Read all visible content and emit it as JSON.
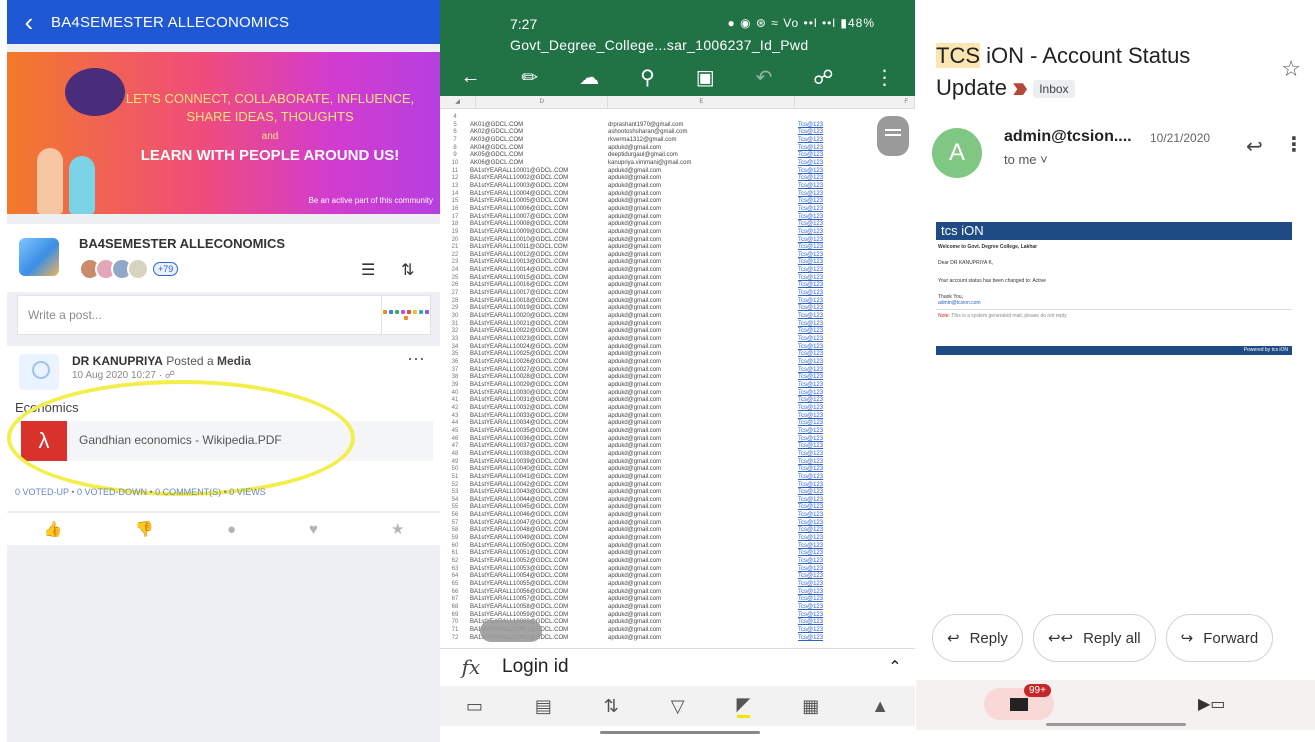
{
  "community": {
    "header_title": "BA4SEMESTER ALLECONOMICS",
    "banner": {
      "line1": "LET'S CONNECT, COLLABORATE, INFLUENCE,",
      "line2": "SHARE IDEAS, THOUGHTS",
      "and": "and",
      "headline": "LEARN WITH PEOPLE AROUND US!",
      "tagline": "Be an active part of this community"
    },
    "group_name": "BA4SEMESTER ALLECONOMICS",
    "member_count": "+79",
    "write_placeholder": "Write a post...",
    "post": {
      "author": "DR KANUPRIYA",
      "action": "Posted a",
      "type": "Media",
      "date": "10 Aug 2020 10:27",
      "title": "Economics",
      "file_name": "Gandhian economics - Wikipedia.PDF",
      "stats": "0 VOTED-UP  •  0 VOTED-DOWN  •  0 COMMENT(S)  •  0 VIEWS"
    },
    "colors": {
      "appbar": "#1f58d4",
      "highlight": "#f2ee4a",
      "pdf": "#d9322b"
    }
  },
  "spreadsheet": {
    "time": "7:27",
    "status_text": "48%",
    "file_title": "Govt_Degree_College...sar_1006237_Id_Pwd",
    "columns": [
      "D",
      "E",
      "F"
    ],
    "rows": [
      [
        "4",
        "",
        "",
        ""
      ],
      [
        "5",
        "AK01@GDCL.COM",
        "drprashant1970@gmail.com",
        "Tcs@123"
      ],
      [
        "6",
        "AK02@GDCL.COM",
        "ashootoshsharan@gmail.com",
        "Tcs@123"
      ],
      [
        "7",
        "AK03@GDCL.COM",
        "rkverma1312@gmail.com",
        "Tcs@123"
      ],
      [
        "8",
        "AK04@GDCL.COM",
        "apdukd@gmail.com",
        "Tcs@123"
      ],
      [
        "9",
        "AK05@GDCL.COM",
        "deeptidurgaul@gmail.com",
        "Tcs@123"
      ],
      [
        "10",
        "AK06@GDCL.COM",
        "kanupriya.vimmani@gmail.com",
        "Tcs@123"
      ],
      [
        "11",
        "BA1stYEARALL10001@GDCL.COM",
        "apdukd@gmail.com",
        "Tcs@123"
      ],
      [
        "12",
        "BA1stYEARALL10002@GDCL.COM",
        "apdukd@gmail.com",
        "Tcs@123"
      ],
      [
        "13",
        "BA1stYEARALL10003@GDCL.COM",
        "apdukd@gmail.com",
        "Tcs@123"
      ],
      [
        "14",
        "BA1stYEARALL10004@GDCL.COM",
        "apdukd@gmail.com",
        "Tcs@123"
      ],
      [
        "15",
        "BA1stYEARALL10005@GDCL.COM",
        "apdukd@gmail.com",
        "Tcs@123"
      ],
      [
        "16",
        "BA1stYEARALL10006@GDCL.COM",
        "apdukd@gmail.com",
        "Tcs@123"
      ],
      [
        "17",
        "BA1stYEARALL10007@GDCL.COM",
        "apdukd@gmail.com",
        "Tcs@123"
      ],
      [
        "18",
        "BA1stYEARALL10008@GDCL.COM",
        "apdukd@gmail.com",
        "Tcs@123"
      ],
      [
        "19",
        "BA1stYEARALL10009@GDCL.COM",
        "apdukd@gmail.com",
        "Tcs@123"
      ],
      [
        "20",
        "BA1stYEARALL10010@GDCL.COM",
        "apdukd@gmail.com",
        "Tcs@123"
      ],
      [
        "21",
        "BA1stYEARALL10011@GDCL.COM",
        "apdukd@gmail.com",
        "Tcs@123"
      ],
      [
        "22",
        "BA1stYEARALL10012@GDCL.COM",
        "apdukd@gmail.com",
        "Tcs@123"
      ],
      [
        "23",
        "BA1stYEARALL10013@GDCL.COM",
        "apdukd@gmail.com",
        "Tcs@123"
      ],
      [
        "24",
        "BA1stYEARALL10014@GDCL.COM",
        "apdukd@gmail.com",
        "Tcs@123"
      ],
      [
        "25",
        "BA1stYEARALL10015@GDCL.COM",
        "apdukd@gmail.com",
        "Tcs@123"
      ],
      [
        "26",
        "BA1stYEARALL10016@GDCL.COM",
        "apdukd@gmail.com",
        "Tcs@123"
      ],
      [
        "27",
        "BA1stYEARALL10017@GDCL.COM",
        "apdukd@gmail.com",
        "Tcs@123"
      ],
      [
        "28",
        "BA1stYEARALL10018@GDCL.COM",
        "apdukd@gmail.com",
        "Tcs@123"
      ],
      [
        "29",
        "BA1stYEARALL10019@GDCL.COM",
        "apdukd@gmail.com",
        "Tcs@123"
      ],
      [
        "30",
        "BA1stYEARALL10020@GDCL.COM",
        "apdukd@gmail.com",
        "Tcs@123"
      ],
      [
        "31",
        "BA1stYEARALL10021@GDCL.COM",
        "apdukd@gmail.com",
        "Tcs@123"
      ],
      [
        "32",
        "BA1stYEARALL10022@GDCL.COM",
        "apdukd@gmail.com",
        "Tcs@123"
      ],
      [
        "33",
        "BA1stYEARALL10023@GDCL.COM",
        "apdukd@gmail.com",
        "Tcs@123"
      ],
      [
        "34",
        "BA1stYEARALL10024@GDCL.COM",
        "apdukd@gmail.com",
        "Tcs@123"
      ],
      [
        "35",
        "BA1stYEARALL10025@GDCL.COM",
        "apdukd@gmail.com",
        "Tcs@123"
      ],
      [
        "36",
        "BA1stYEARALL10026@GDCL.COM",
        "apdukd@gmail.com",
        "Tcs@123"
      ],
      [
        "37",
        "BA1stYEARALL10027@GDCL.COM",
        "apdukd@gmail.com",
        "Tcs@123"
      ],
      [
        "38",
        "BA1stYEARALL10028@GDCL.COM",
        "apdukd@gmail.com",
        "Tcs@123"
      ],
      [
        "39",
        "BA1stYEARALL10029@GDCL.COM",
        "apdukd@gmail.com",
        "Tcs@123"
      ],
      [
        "40",
        "BA1stYEARALL10030@GDCL.COM",
        "apdukd@gmail.com",
        "Tcs@123"
      ],
      [
        "41",
        "BA1stYEARALL10031@GDCL.COM",
        "apdukd@gmail.com",
        "Tcs@123"
      ],
      [
        "42",
        "BA1stYEARALL10032@GDCL.COM",
        "apdukd@gmail.com",
        "Tcs@123"
      ],
      [
        "43",
        "BA1stYEARALL10033@GDCL.COM",
        "apdukd@gmail.com",
        "Tcs@123"
      ],
      [
        "44",
        "BA1stYEARALL10034@GDCL.COM",
        "apdukd@gmail.com",
        "Tcs@123"
      ],
      [
        "45",
        "BA1stYEARALL10035@GDCL.COM",
        "apdukd@gmail.com",
        "Tcs@123"
      ],
      [
        "46",
        "BA1stYEARALL10036@GDCL.COM",
        "apdukd@gmail.com",
        "Tcs@123"
      ],
      [
        "47",
        "BA1stYEARALL10037@GDCL.COM",
        "apdukd@gmail.com",
        "Tcs@123"
      ],
      [
        "48",
        "BA1stYEARALL10038@GDCL.COM",
        "apdukd@gmail.com",
        "Tcs@123"
      ],
      [
        "49",
        "BA1stYEARALL10039@GDCL.COM",
        "apdukd@gmail.com",
        "Tcs@123"
      ],
      [
        "50",
        "BA1stYEARALL10040@GDCL.COM",
        "apdukd@gmail.com",
        "Tcs@123"
      ],
      [
        "51",
        "BA1stYEARALL10041@GDCL.COM",
        "apdukd@gmail.com",
        "Tcs@123"
      ],
      [
        "52",
        "BA1stYEARALL10042@GDCL.COM",
        "apdukd@gmail.com",
        "Tcs@123"
      ],
      [
        "53",
        "BA1stYEARALL10043@GDCL.COM",
        "apdukd@gmail.com",
        "Tcs@123"
      ],
      [
        "54",
        "BA1stYEARALL10044@GDCL.COM",
        "apdukd@gmail.com",
        "Tcs@123"
      ],
      [
        "55",
        "BA1stYEARALL10045@GDCL.COM",
        "apdukd@gmail.com",
        "Tcs@123"
      ],
      [
        "56",
        "BA1stYEARALL10046@GDCL.COM",
        "apdukd@gmail.com",
        "Tcs@123"
      ],
      [
        "57",
        "BA1stYEARALL10047@GDCL.COM",
        "apdukd@gmail.com",
        "Tcs@123"
      ],
      [
        "58",
        "BA1stYEARALL10048@GDCL.COM",
        "apdukd@gmail.com",
        "Tcs@123"
      ],
      [
        "59",
        "BA1stYEARALL10049@GDCL.COM",
        "apdukd@gmail.com",
        "Tcs@123"
      ],
      [
        "60",
        "BA1stYEARALL10050@GDCL.COM",
        "apdukd@gmail.com",
        "Tcs@123"
      ],
      [
        "61",
        "BA1stYEARALL10051@GDCL.COM",
        "apdukd@gmail.com",
        "Tcs@123"
      ],
      [
        "62",
        "BA1stYEARALL10052@GDCL.COM",
        "apdukd@gmail.com",
        "Tcs@123"
      ],
      [
        "63",
        "BA1stYEARALL10053@GDCL.COM",
        "apdukd@gmail.com",
        "Tcs@123"
      ],
      [
        "64",
        "BA1stYEARALL10054@GDCL.COM",
        "apdukd@gmail.com",
        "Tcs@123"
      ],
      [
        "65",
        "BA1stYEARALL10055@GDCL.COM",
        "apdukd@gmail.com",
        "Tcs@123"
      ],
      [
        "66",
        "BA1stYEARALL10056@GDCL.COM",
        "apdukd@gmail.com",
        "Tcs@123"
      ],
      [
        "67",
        "BA1stYEARALL10057@GDCL.COM",
        "apdukd@gmail.com",
        "Tcs@123"
      ],
      [
        "68",
        "BA1stYEARALL10058@GDCL.COM",
        "apdukd@gmail.com",
        "Tcs@123"
      ],
      [
        "69",
        "BA1stYEARALL10059@GDCL.COM",
        "apdukd@gmail.com",
        "Tcs@123"
      ],
      [
        "70",
        "BA1stYEARALL10060@GDCL.COM",
        "apdukd@gmail.com",
        "Tcs@123"
      ],
      [
        "71",
        "BA1stYEARALL10061@GDCL.COM",
        "apdukd@gmail.com",
        "Tcs@123"
      ],
      [
        "72",
        "BA1stYEARALL10062@GDCL.COM",
        "apdukd@gmail.com",
        "Tcs@123"
      ]
    ],
    "formula_value": "Login id",
    "colors": {
      "ribbon": "#217346",
      "link": "#2a62c9"
    }
  },
  "email": {
    "subject_highlight": "TCS",
    "subject_rest": " iON - Account Status Update",
    "label": "Inbox",
    "avatar_letter": "A",
    "sender": "admin@tcsion....",
    "date": "10/21/2020",
    "to": "to me",
    "body": {
      "logo": "tcs iON",
      "greeting": "Welcome to Govt. Degree College, Lakhar",
      "salutation": "Dear DR KANUPRIYA K,",
      "message": "Your account status has been changed to: Active",
      "thanks": "Thank You,",
      "signature": "admin@tcsion.com",
      "note_label": "Note:",
      "note": "This is a system generated mail, please do not reply",
      "footer": "Powered by tcs iON"
    },
    "buttons": {
      "reply": "Reply",
      "reply_all": "Reply all",
      "forward": "Forward"
    },
    "unread_badge": "99+",
    "colors": {
      "avatar": "#80c783",
      "banner": "#1f4b85",
      "badge": "#c62828"
    }
  }
}
